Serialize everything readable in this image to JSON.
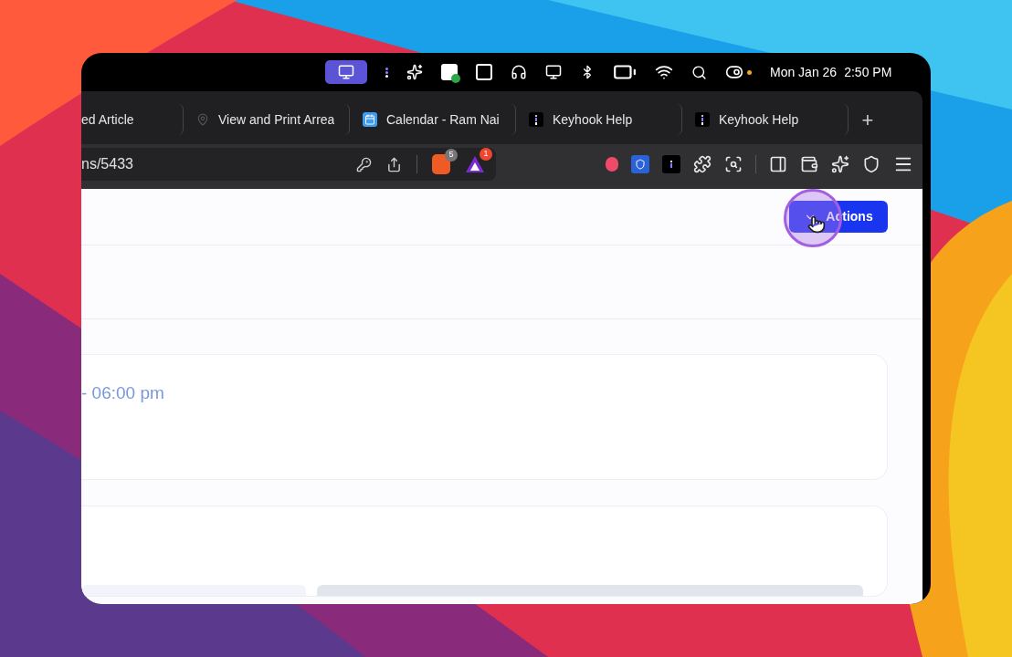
{
  "menu_bar": {
    "date": "Mon Jan 26",
    "time": "2:50 PM",
    "notification_dot": true
  },
  "tabs": [
    {
      "title": "ed Article",
      "kind": "plain",
      "selected": false
    },
    {
      "title": "View and Print Arrea",
      "kind": "pin",
      "selected": false
    },
    {
      "title": "Calendar - Ram Nai",
      "kind": "calendar",
      "selected": false
    },
    {
      "title": "Keyhook Help",
      "kind": "keyhook",
      "selected": false
    },
    {
      "title": "Keyhook Help",
      "kind": "keyhook",
      "selected": false
    }
  ],
  "new_tab": "+",
  "address_bar": {
    "url": "ns/5433",
    "shields_count": "5",
    "rewards_count": "1"
  },
  "page": {
    "actions_button": "Actions",
    "event_time": "- 06:00 pm"
  }
}
